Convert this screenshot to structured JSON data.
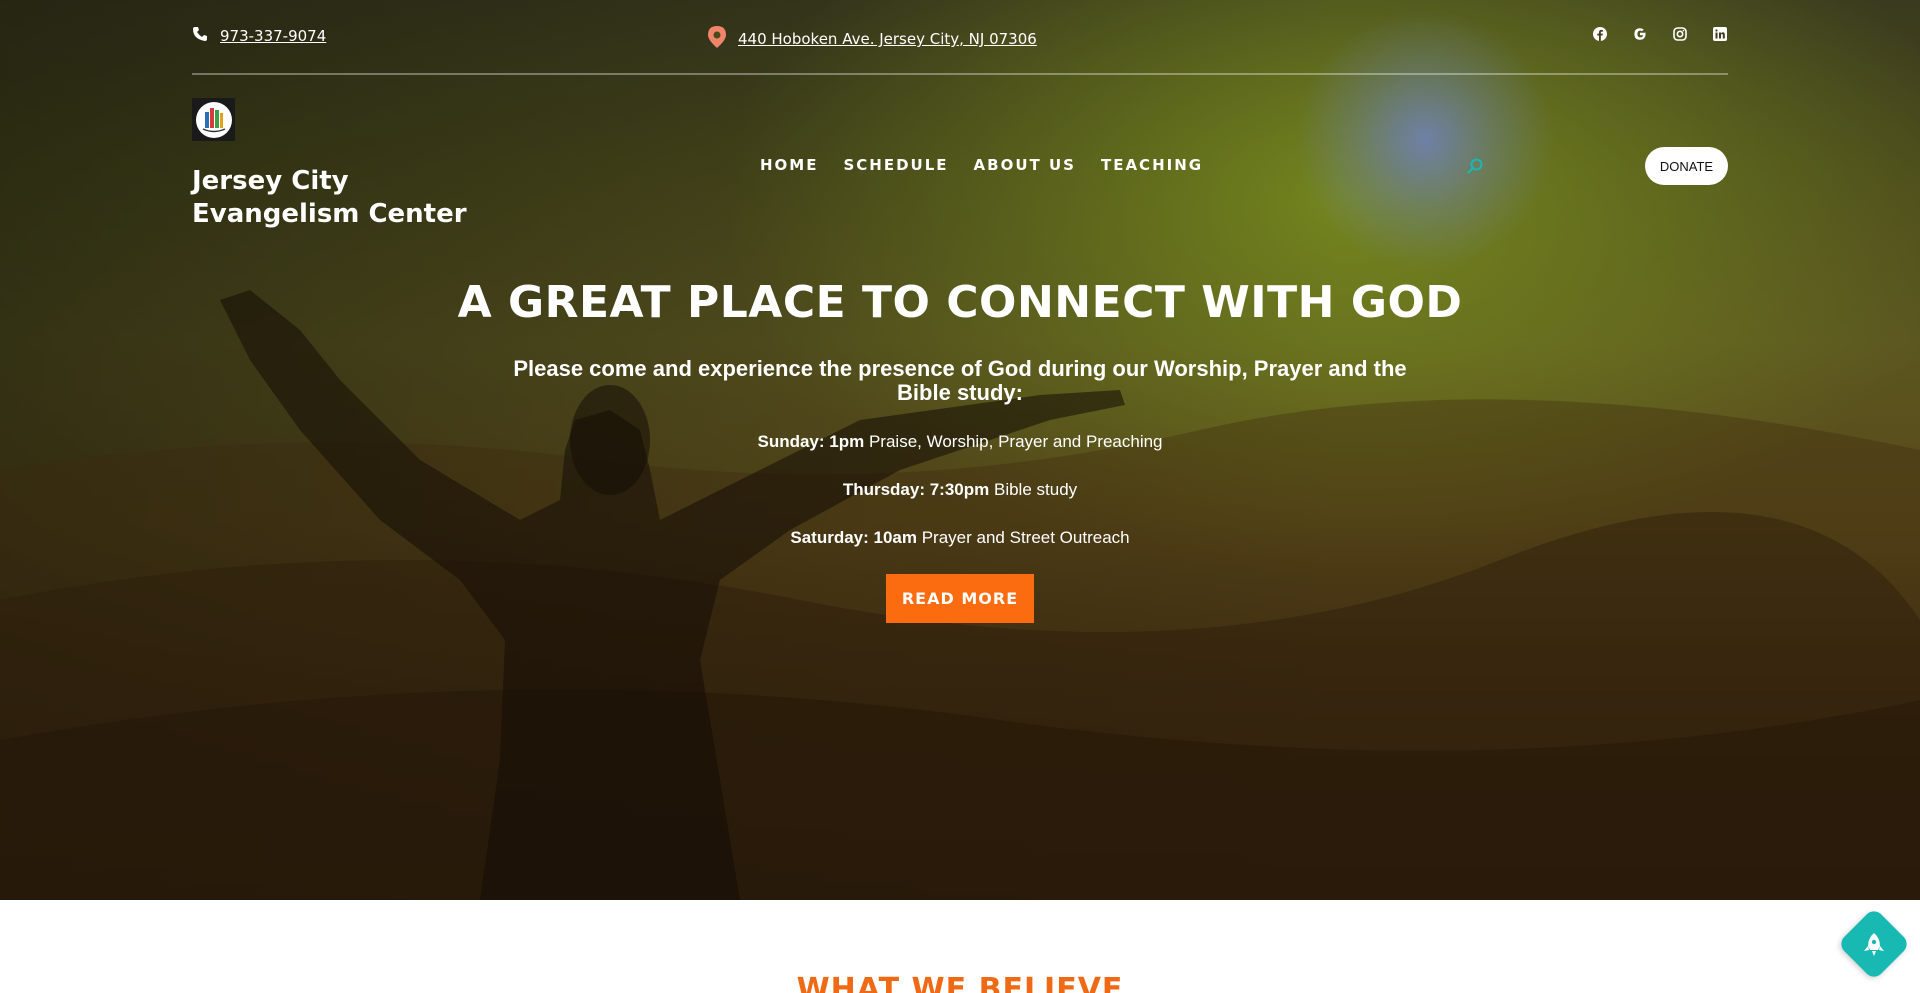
{
  "topbar": {
    "phone": "973-337-9074",
    "address": "440 Hoboken Ave. Jersey City, NJ 07306",
    "social_icons": [
      "facebook-icon",
      "google-icon",
      "instagram-icon",
      "linkedin-icon"
    ]
  },
  "header": {
    "site_title": "Jersey City Evangelism Center",
    "nav": [
      {
        "label": "HOME"
      },
      {
        "label": "SCHEDULE"
      },
      {
        "label": "ABOUT US"
      },
      {
        "label": "TEACHING"
      }
    ],
    "donate_label": "DONATE"
  },
  "hero": {
    "title": "A GREAT PLACE TO CONNECT WITH GOD",
    "subtitle": "Please come and experience the presence of God during our Worship, Prayer and the Bible study:",
    "schedule": [
      {
        "day": "Sunday: 1pm",
        "desc": " Praise, Worship, Prayer and Preaching"
      },
      {
        "day": "Thursday: 7:30pm",
        "desc": " Bible study"
      },
      {
        "day": "Saturday: 10am",
        "desc": " Prayer and Street Outreach"
      }
    ],
    "button_label": "READ MORE"
  },
  "section": {
    "heading": "WHAT WE BELIEVE"
  },
  "colors": {
    "accent": "#fb6b10",
    "teal": "#19b9b3",
    "address_pin": "#f0856a"
  }
}
